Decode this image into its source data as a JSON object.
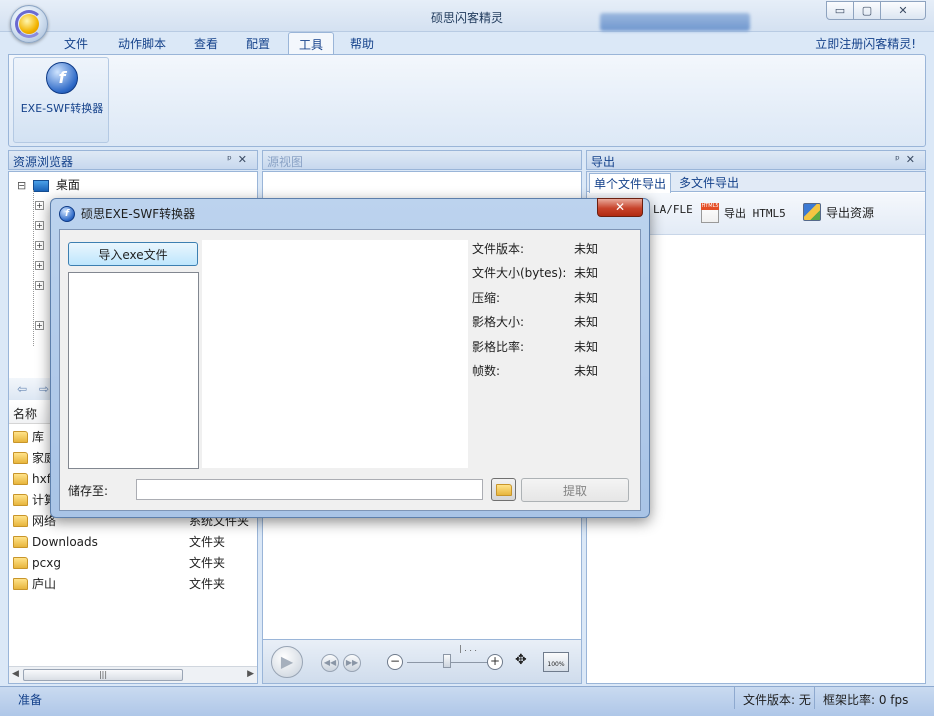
{
  "window": {
    "title": "硕思闪客精灵",
    "controls": {
      "minimize": "▭",
      "maximize": "▢",
      "close": "✕"
    }
  },
  "menu": {
    "tabs": [
      {
        "label": "文件"
      },
      {
        "label": "动作脚本"
      },
      {
        "label": "查看"
      },
      {
        "label": "配置"
      },
      {
        "label": "工具",
        "active": true
      },
      {
        "label": "帮助"
      }
    ],
    "register_link": "立即注册闪客精灵!"
  },
  "ribbon": {
    "exe_swf_button": {
      "label": "EXE-SWF转换器",
      "icon_glyph": "f"
    }
  },
  "left_pane": {
    "title": "资源浏览器",
    "pin": "ᵖ",
    "close": "✕",
    "tree_root": {
      "expander": "⊟",
      "label": "桌面"
    },
    "list_header": {
      "name_col": "名称"
    },
    "items": [
      {
        "name": "库",
        "type": ""
      },
      {
        "name": "家庭",
        "type": ""
      },
      {
        "name": "hxf",
        "type": ""
      },
      {
        "name": "计算",
        "type": ""
      },
      {
        "name": "网络",
        "type": "系统文件夹"
      },
      {
        "name": "Downloads",
        "type": "文件夹"
      },
      {
        "name": "pcxg",
        "type": "文件夹"
      },
      {
        "name": "庐山",
        "type": "文件夹"
      }
    ],
    "nav_back": "⇦",
    "nav_forward": "⇨",
    "scroll_grip": "|||"
  },
  "mid_pane": {
    "title": "源视图",
    "player": {
      "zoom_minus": "−",
      "zoom_plus": "+",
      "zoom_100": "100%",
      "play": "▶"
    }
  },
  "right_pane": {
    "title": "导出",
    "pin": "ᵖ",
    "close": "✕",
    "tabs": [
      {
        "label": "单个文件导出",
        "active": true
      },
      {
        "label": "多文件导出"
      }
    ],
    "tools": {
      "fla": "LA/FLE",
      "html5": "导出 HTML5",
      "resources": "导出资源"
    }
  },
  "status": {
    "ready": "准备",
    "file_version": "文件版本: 无",
    "frame_ratio": "框架比率: 0 fps"
  },
  "dialog": {
    "title": "硕思EXE-SWF转换器",
    "close": "✕",
    "import_button": "导入exe文件",
    "info": [
      {
        "label": "文件版本:",
        "value": "未知"
      },
      {
        "label": "文件大小(bytes):",
        "value": "未知"
      },
      {
        "label": "压缩:",
        "value": "未知"
      },
      {
        "label": "影格大小:",
        "value": "未知"
      },
      {
        "label": "影格比率:",
        "value": "未知"
      },
      {
        "label": "帧数:",
        "value": "未知"
      }
    ],
    "save_label": "储存至:",
    "save_value": "",
    "extract_button": "提取"
  }
}
